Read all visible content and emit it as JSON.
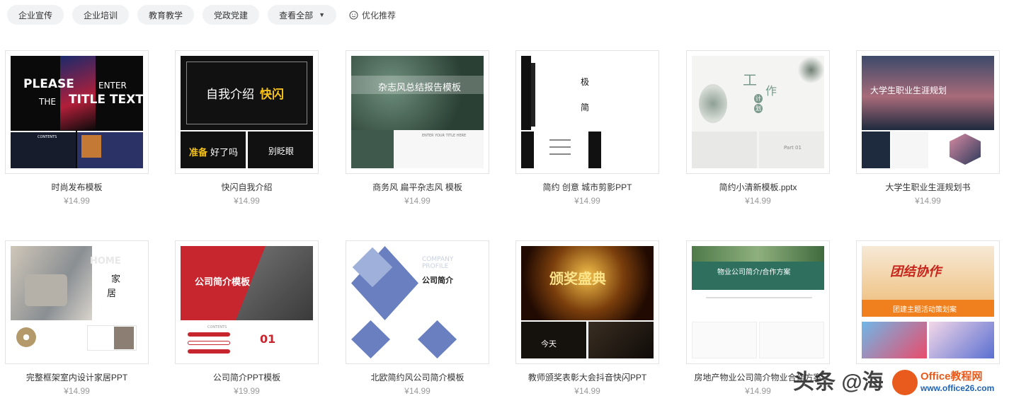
{
  "filters": {
    "tags": [
      "企业宣传",
      "企业培训",
      "教育教学",
      "党政党建"
    ],
    "view_all": "查看全部",
    "recommend": "优化推荐"
  },
  "cards": [
    {
      "title": "时尚发布模板",
      "price": "¥14.99",
      "thumb_text": [
        "PLEASE",
        "ENTER",
        "THE",
        "TITLE TEXT",
        "CONTENTS"
      ]
    },
    {
      "title": "快闪自我介绍",
      "price": "¥14.99",
      "thumb_text": [
        "自我介绍",
        "快闪",
        "准备",
        "好了吗",
        "别眨眼"
      ]
    },
    {
      "title": "商务风 扁平杂志风 模板",
      "price": "¥14.99",
      "thumb_text": [
        "杂志风总结报告模板",
        "ENTER YOUR TITLE HERE"
      ]
    },
    {
      "title": "简约 创意 城市剪影PPT",
      "price": "¥14.99",
      "thumb_text": [
        "极",
        "简"
      ]
    },
    {
      "title": "简约小清新模板.pptx",
      "price": "¥14.99",
      "thumb_text": [
        "工",
        "作",
        "计",
        "划",
        "Part 01"
      ]
    },
    {
      "title": "大学生职业生涯规划书",
      "price": "¥14.99",
      "thumb_text": [
        "大学生职业生涯规划"
      ]
    },
    {
      "title": "完整框架室内设计家居PPT",
      "price": "¥14.99",
      "thumb_text": [
        "HOME",
        "家",
        "居"
      ]
    },
    {
      "title": "公司简介PPT模板",
      "price": "¥19.99",
      "thumb_text": [
        "公司简介模板",
        "CONTENTS",
        "01"
      ]
    },
    {
      "title": "北欧简约风公司简介模板",
      "price": "¥14.99",
      "thumb_text": [
        "COMPANY",
        "PROFILE",
        "公司简介"
      ]
    },
    {
      "title": "教师颁奖表彰大会抖音快闪PPT",
      "price": "¥14.99",
      "thumb_text": [
        "颁奖盛典",
        "今天"
      ]
    },
    {
      "title": "房地产物业公司简介物业合作方案",
      "price": "¥14.99",
      "thumb_text": [
        "物业公司简介/合作方案"
      ]
    },
    {
      "title": "",
      "price": "",
      "thumb_text": [
        "团结协作",
        "团建主题活动策划案"
      ]
    }
  ],
  "watermark": {
    "text": "头条 @海",
    "brand": "Office教程网",
    "url": "www.office26.com"
  },
  "colors": {
    "pill_bg": "#f1f2f4",
    "price": "#999999",
    "border": "#e3e3e3"
  }
}
